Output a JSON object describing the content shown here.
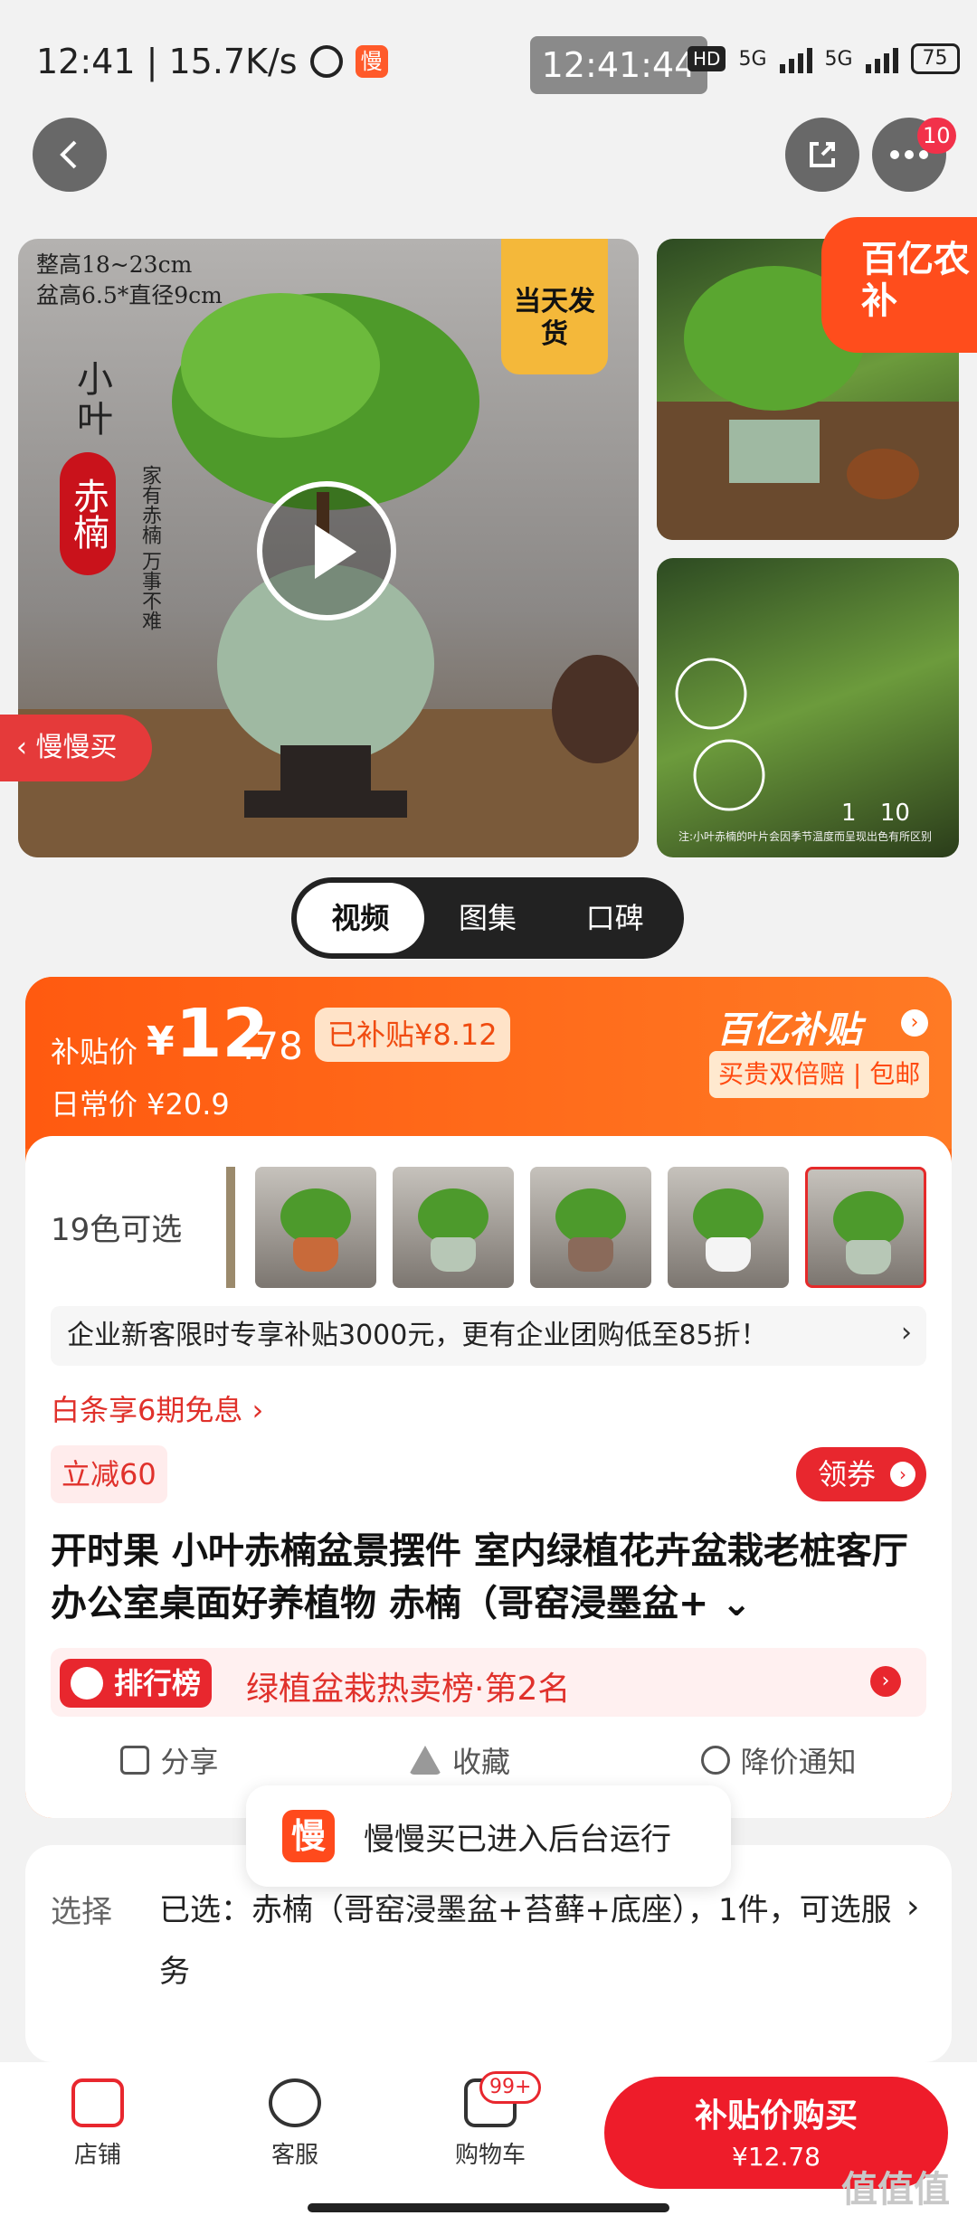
{
  "status_bar": {
    "time_speed": "12:41 | 15.7K/s",
    "app_badge": "慢",
    "clock": "12:41:44",
    "hd": "HD",
    "network_1": "5G",
    "network_2": "5G",
    "battery": "75"
  },
  "nav": {
    "notification_count": "10"
  },
  "gallery": {
    "spec_text": "整高18~23cm\n盆高6.5*直径9cm",
    "title_small": "小叶",
    "title_highlight": "赤楠",
    "slogan": "家有赤楠 万事不难",
    "ship_tag": "当天发货",
    "back_tag": "慢慢买",
    "corner_badge": "百亿农补",
    "counter_current": "1",
    "counter_total": "10",
    "caption": "注:小叶赤楠的叶片会因季节温度而呈现出色有所区别"
  },
  "media_tabs": [
    {
      "label": "视频",
      "active": true
    },
    {
      "label": "图集",
      "active": false
    },
    {
      "label": "口碑",
      "active": false
    }
  ],
  "price": {
    "label": "补贴价",
    "yen": "¥",
    "integer": "12",
    "decimal": ".78",
    "subsidy": "已补贴¥8.12",
    "regular": "日常价 ¥20.9",
    "brand": "百亿补贴",
    "guarantee": "买贵双倍赔 | 包邮"
  },
  "variants": {
    "count_label": "19色可选",
    "swatch_count": 5
  },
  "promo": {
    "text": "企业新客限时专享补贴3000元，更有企业团购低至85折！",
    "chevron": "›"
  },
  "installment": "白条享6期免息 ›",
  "discount_tag": "立减60",
  "coupon_button": "领券",
  "product_title": "开时果 小叶赤楠盆景摆件 室内绿植花卉盆栽老桩客厅办公室桌面好养植物 赤楠（哥窑浸墨盆+ ⌄",
  "ranking": {
    "badge": "排行榜",
    "text": "绿植盆栽热卖榜·第2名"
  },
  "actions": {
    "share": "分享",
    "favorite": "收藏",
    "price_alert": "降价通知"
  },
  "toast": {
    "logo": "慢",
    "text": "慢慢买已进入后台运行"
  },
  "selection": {
    "label": "选择",
    "value": "已选：赤楠（哥窑浸墨盆+苔藓+底座），1件，可选服务",
    "chevron": "›"
  },
  "bottom_bar": {
    "shop": "店铺",
    "service": "客服",
    "cart": "购物车",
    "cart_badge": "99+",
    "buy_main": "补贴价购买",
    "buy_sub": "¥12.78"
  },
  "watermark": "值值值",
  "colors": {
    "accent_orange": "#ff6a1a",
    "accent_red": "#e8272e"
  }
}
